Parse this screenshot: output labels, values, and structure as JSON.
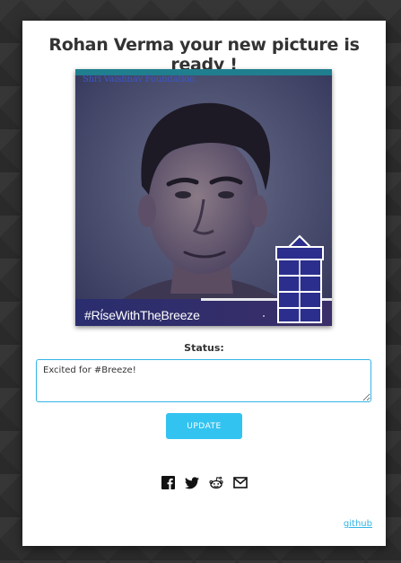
{
  "header": {
    "title": "Rohan Verma your new picture is ready !"
  },
  "photo": {
    "caption": "Shri Vaishnav Foundation",
    "hashtag": "#RiseWithTheBreeze",
    "overlay_color": "#3a3f7a",
    "logo_icon": "breeze-tower-logo"
  },
  "status": {
    "label": "Status:",
    "value": "Excited for #Breeze!"
  },
  "actions": {
    "update_label": "UPDATE",
    "update_color": "#33c3f0"
  },
  "share": {
    "icons": [
      "facebook-icon",
      "twitter-icon",
      "reddit-icon",
      "email-icon"
    ]
  },
  "footer": {
    "github_label": "github",
    "link_color": "#33b5e5"
  }
}
